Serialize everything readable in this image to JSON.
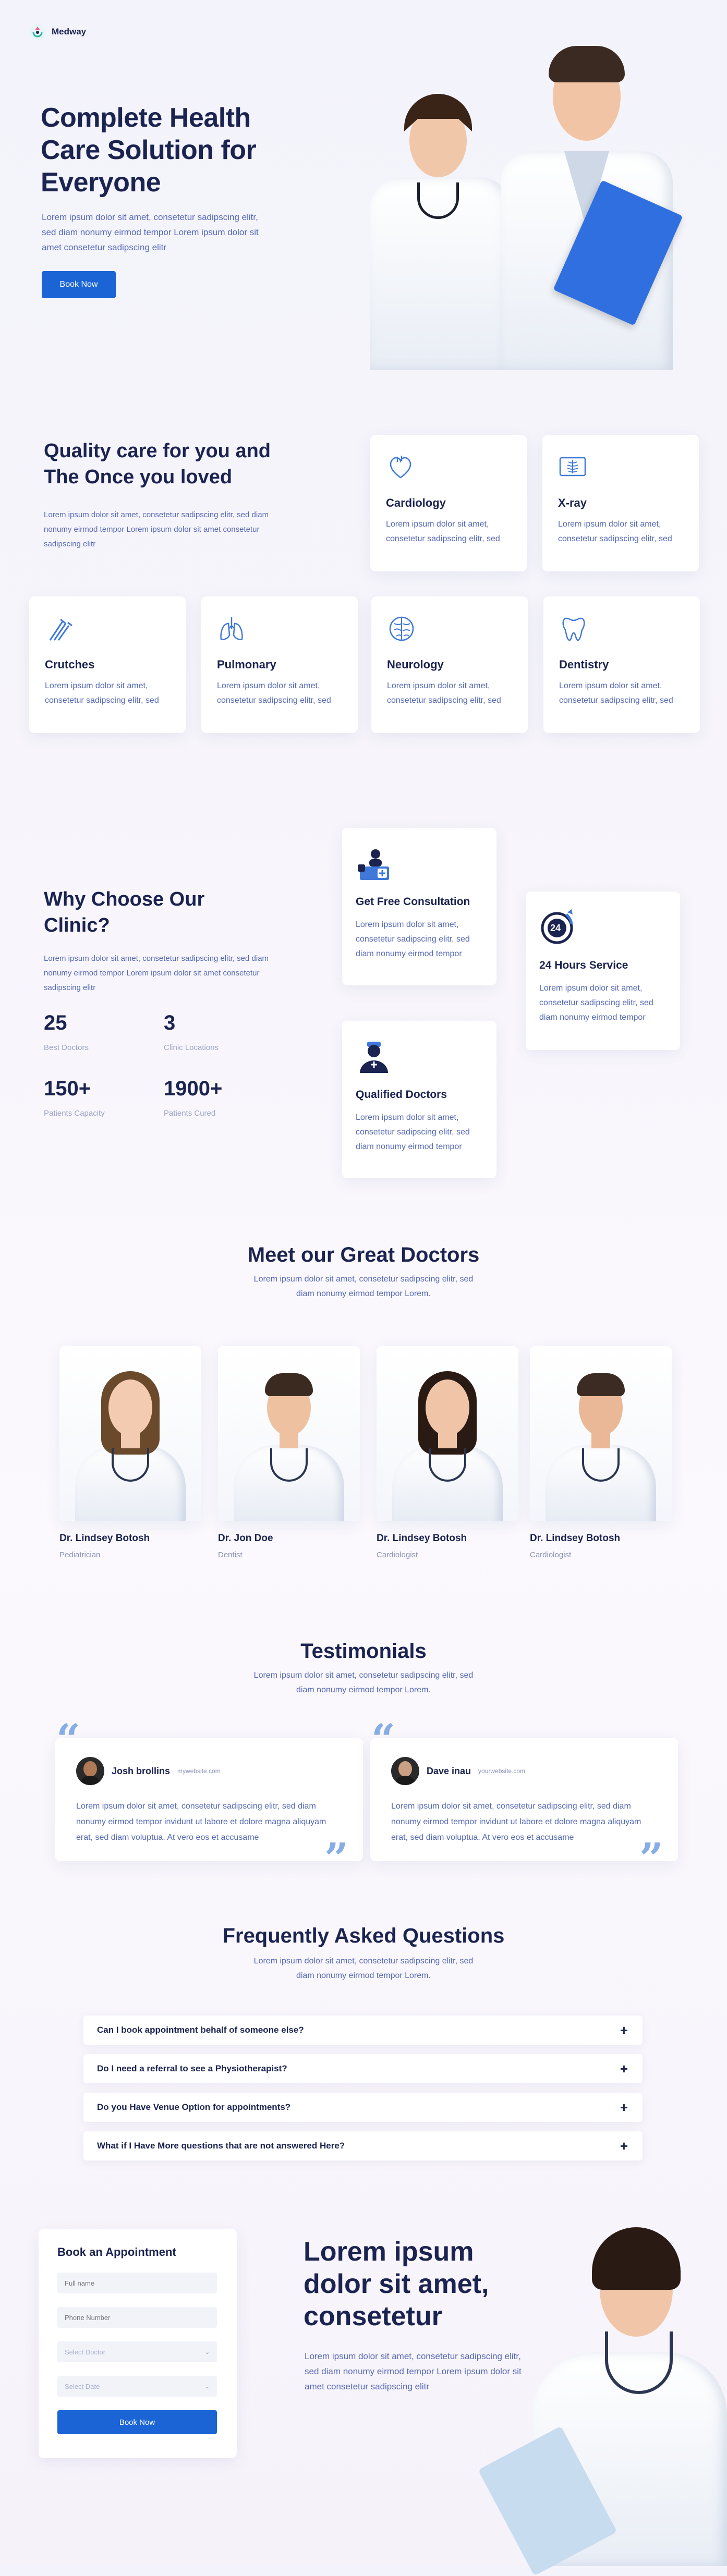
{
  "header": {
    "brand": "Medway"
  },
  "hero": {
    "title": "Complete Health Care Solution for Everyone",
    "description": "Lorem ipsum dolor sit amet, consetetur sadipscing elitr, sed diam nonumy eirmod tempor Lorem ipsum dolor sit amet consetetur sadipscing elitr",
    "button": "Book Now"
  },
  "quality": {
    "title": "Quality care for you and The Once you loved",
    "description": "Lorem ipsum dolor sit amet, consetetur sadipscing elitr, sed diam nonumy eirmod tempor Lorem ipsum dolor sit amet consetetur sadipscing elitr",
    "services": [
      {
        "name": "Cardiology",
        "desc": "Lorem ipsum dolor sit amet, consetetur sadipscing elitr, sed",
        "icon": "heart-icon"
      },
      {
        "name": "X-ray",
        "desc": "Lorem ipsum dolor sit amet, consetetur sadipscing elitr, sed",
        "icon": "xray-icon"
      },
      {
        "name": "Crutches",
        "desc": "Lorem ipsum dolor sit amet, consetetur sadipscing elitr, sed",
        "icon": "crutches-icon"
      },
      {
        "name": "Pulmonary",
        "desc": "Lorem ipsum dolor sit amet, consetetur sadipscing elitr, sed",
        "icon": "lungs-icon"
      },
      {
        "name": "Neurology",
        "desc": "Lorem ipsum dolor sit amet, consetetur sadipscing elitr, sed",
        "icon": "brain-icon"
      },
      {
        "name": "Dentistry",
        "desc": "Lorem ipsum dolor sit amet, consetetur sadipscing elitr, sed",
        "icon": "tooth-icon"
      }
    ]
  },
  "why": {
    "title": "Why Choose Our Clinic?",
    "description": "Lorem ipsum dolor sit amet, consetetur sadipscing elitr, sed diam nonumy eirmod tempor Lorem ipsum dolor sit amet consetetur sadipscing elitr",
    "stats": [
      {
        "value": "25",
        "label": "Best Doctors"
      },
      {
        "value": "3",
        "label": "Clinic Locations"
      },
      {
        "value": "150+",
        "label": "Patients Capacity"
      },
      {
        "value": "1900+",
        "label": "Patients Cured"
      }
    ],
    "features": [
      {
        "name": "Get Free Consultation",
        "desc": "Lorem ipsum dolor sit amet, consetetur sadipscing elitr, sed diam nonumy eirmod tempor",
        "icon": "consultation-icon"
      },
      {
        "name": "24 Hours Service",
        "desc": "Lorem ipsum dolor sit amet, consetetur sadipscing elitr, sed diam nonumy eirmod tempor",
        "icon": "24-hours-icon"
      },
      {
        "name": "Qualified Doctors",
        "desc": "Lorem ipsum dolor sit amet, consetetur sadipscing elitr, sed diam nonumy eirmod tempor",
        "icon": "doctor-icon"
      }
    ],
    "clock_label": "24"
  },
  "doctors": {
    "title": "Meet our Great Doctors",
    "description": "Lorem ipsum dolor sit amet, consetetur sadipscing elitr, sed diam nonumy eirmod tempor Lorem.",
    "list": [
      {
        "name": "Dr. Lindsey Botosh",
        "role": "Pediatrician"
      },
      {
        "name": "Dr. Jon Doe",
        "role": "Dentist"
      },
      {
        "name": "Dr. Lindsey Botosh",
        "role": "Cardiologist"
      },
      {
        "name": "Dr. Lindsey Botosh",
        "role": "Cardiologist"
      }
    ]
  },
  "testimonials": {
    "title": "Testimonials",
    "description": "Lorem ipsum dolor sit amet, consetetur sadipscing elitr, sed diam nonumy eirmod tempor Lorem.",
    "items": [
      {
        "name": "Josh brollins",
        "site": "mywebsite.com",
        "text": "Lorem ipsum dolor sit amet, consetetur sadipscing elitr, sed diam nonumy eirmod tempor invidunt ut labore et dolore magna aliquyam erat, sed diam voluptua. At vero eos et accusame"
      },
      {
        "name": "Dave inau",
        "site": "yourwebsite.com",
        "text": "Lorem ipsum dolor sit amet, consetetur sadipscing elitr, sed diam nonumy eirmod tempor invidunt ut labore et dolore magna aliquyam erat, sed diam voluptua. At vero eos et accusame"
      }
    ],
    "open_quote": "“",
    "close_quote": "”"
  },
  "faq": {
    "title": "Frequently Asked Questions",
    "description": "Lorem ipsum dolor sit amet, consetetur sadipscing elitr, sed diam nonumy eirmod tempor Lorem.",
    "items": [
      "Can I book appointment behalf of someone else?",
      "Do I need a referral to see a Physiotherapist?",
      "Do you Have Venue Option for appointments?",
      "What if I Have More questions that are not answered Here?"
    ],
    "expand_symbol": "+"
  },
  "appointment": {
    "title": "Book an Appointment",
    "full_name_placeholder": "Full name",
    "phone_placeholder": "Phone Number",
    "doctor_select": "Select Doctor",
    "date_select": "Select Date",
    "button": "Book Now"
  },
  "cta": {
    "title": "Lorem ipsum dolor sit amet, consetetur",
    "description": "Lorem ipsum dolor sit amet, consetetur sadipscing elitr, sed diam nonumy eirmod tempor Lorem ipsum dolor sit amet consetetur sadipscing elitr"
  },
  "colors": {
    "accent": "#1a64d6",
    "text": "#1b2350",
    "muted": "#5468b5",
    "icon": "#3f78d8"
  }
}
